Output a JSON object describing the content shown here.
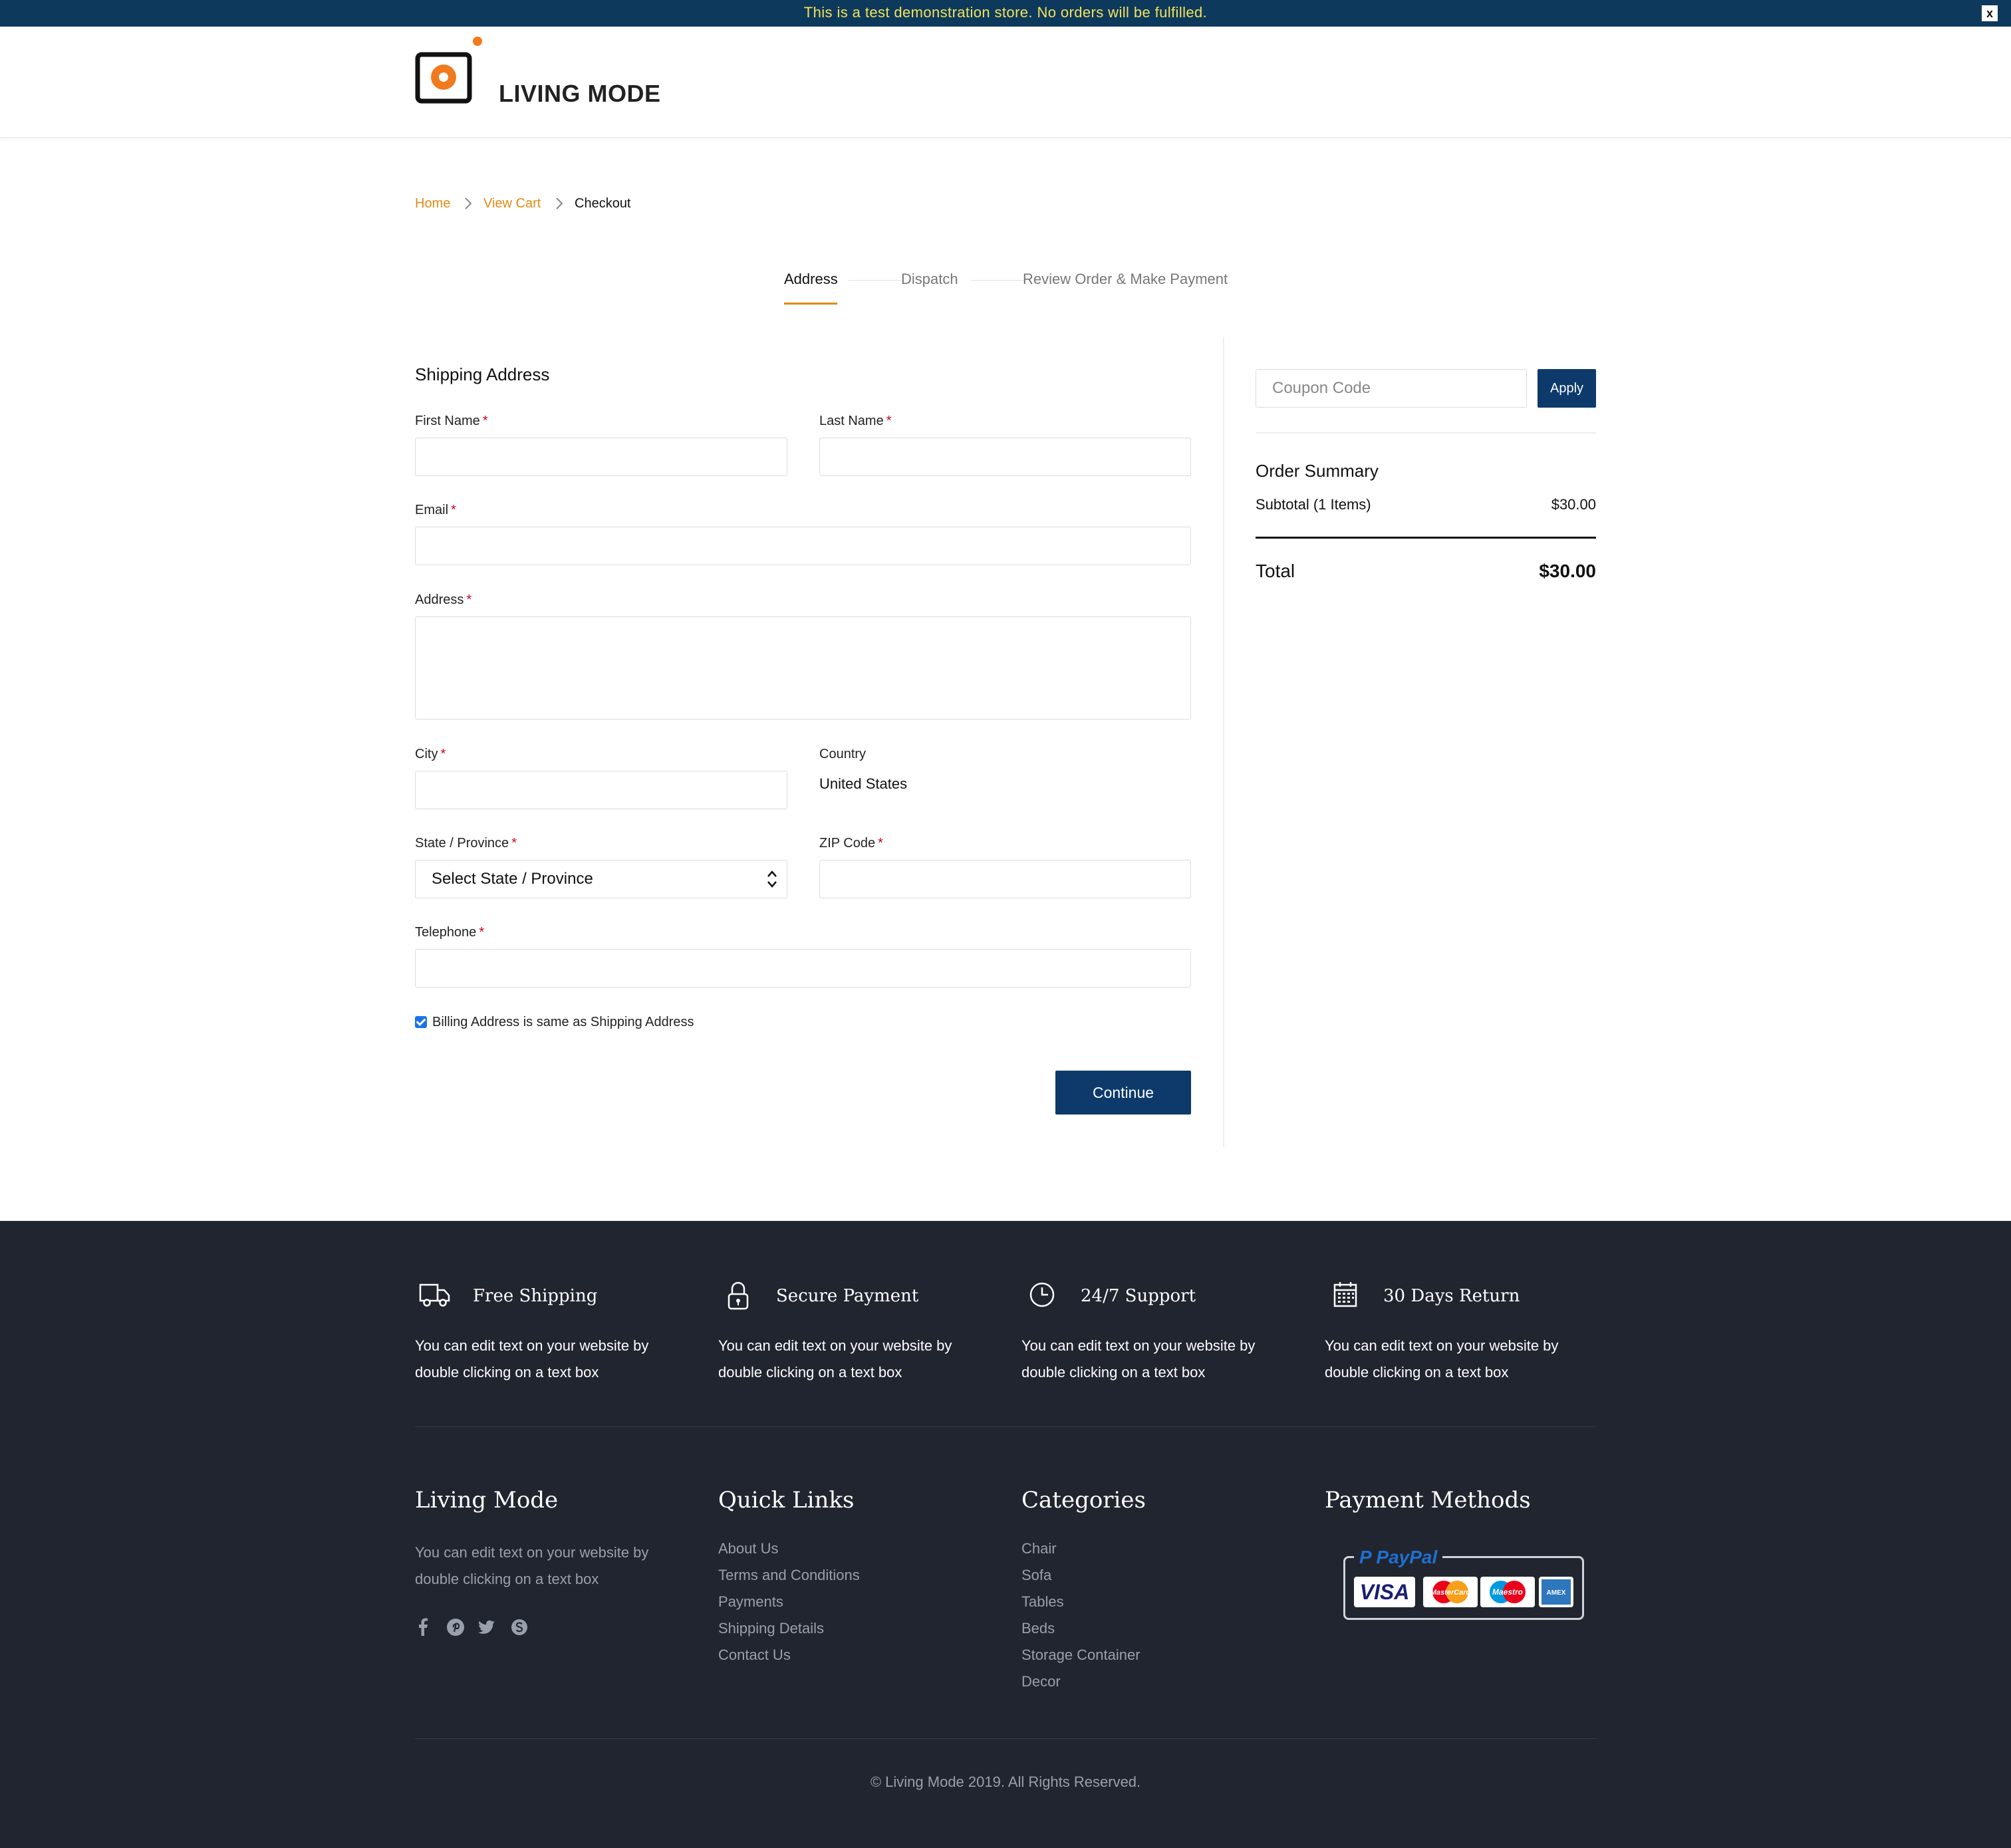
{
  "banner": {
    "text": "This is a test demonstration store. No orders will be fulfilled.",
    "close": "x"
  },
  "brand": {
    "name": "LIVING MODE"
  },
  "breadcrumb": {
    "home": "Home",
    "cart": "View Cart",
    "current": "Checkout"
  },
  "steps": {
    "address": "Address",
    "dispatch": "Dispatch",
    "review": "Review Order & Make Payment"
  },
  "form": {
    "title": "Shipping Address",
    "first_name": "First Name",
    "last_name": "Last Name",
    "email": "Email",
    "address": "Address",
    "city": "City",
    "country_label": "Country",
    "country_value": "United States",
    "state": "State / Province",
    "state_select": "Select State / Province",
    "zip": "ZIP Code",
    "telephone": "Telephone",
    "required_mark": "*",
    "billing_same": "Billing Address is same as Shipping Address",
    "continue": "Continue"
  },
  "summary": {
    "coupon_placeholder": "Coupon Code",
    "apply": "Apply",
    "title": "Order Summary",
    "subtotal_label": "Subtotal (1 Items)",
    "subtotal_value": "$30.00",
    "total_label": "Total",
    "total_value": "$30.00"
  },
  "features": [
    {
      "icon": "truck-icon",
      "title": "Free Shipping",
      "text": "You can edit text on your website by double clicking on a text box"
    },
    {
      "icon": "lock-icon",
      "title": "Secure Payment",
      "text": "You can edit text on your website by double clicking on a text box"
    },
    {
      "icon": "clock-icon",
      "title": "24/7 Support",
      "text": "You can edit text on your website by double clicking on a text box"
    },
    {
      "icon": "calendar-icon",
      "title": "30 Days Return",
      "text": "You can edit text on your website by double clicking on a text box"
    }
  ],
  "footer": {
    "about_title": "Living Mode",
    "about_text": "You can edit text on your website by double clicking on a text box",
    "social": [
      "facebook-icon",
      "pinterest-icon",
      "twitter-icon",
      "skype-icon"
    ],
    "quick_title": "Quick Links",
    "quick_links": [
      "About Us",
      "Terms and Conditions",
      "Payments",
      "Shipping Details",
      "Contact Us"
    ],
    "cat_title": "Categories",
    "categories": [
      "Chair",
      "Sofa",
      "Tables",
      "Beds",
      "Storage Container",
      "Decor"
    ],
    "pay_title": "Payment Methods",
    "pay_brand": "PayPal",
    "cards": [
      "VISA",
      "MasterCard",
      "Maestro",
      "AMEX"
    ],
    "copyright": "© Living Mode 2019. All Rights Reserved."
  },
  "colors": {
    "navy": "#0d3a6a",
    "accent": "#e08a16",
    "footer": "#20252f",
    "banner_text": "#f5e15b"
  }
}
